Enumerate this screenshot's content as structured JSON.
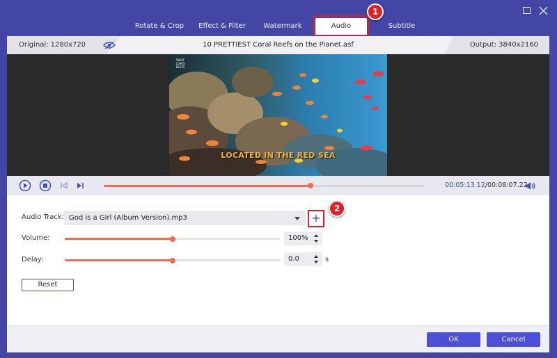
{
  "tabs": [
    {
      "label": "Rotate & Crop",
      "active": false
    },
    {
      "label": "Effect & Filter",
      "active": false
    },
    {
      "label": "Watermark",
      "active": false
    },
    {
      "label": "Audio",
      "active": true
    },
    {
      "label": "Subtitle",
      "active": false
    }
  ],
  "callouts": {
    "one": "1",
    "two": "2"
  },
  "info": {
    "original": "Original: 1280x720",
    "file_name": "10 PRETTIEST Coral Reefs on the Planet.asf",
    "output": "Output: 3840x2160"
  },
  "video": {
    "caption": "LOCATED IN THE RED SEA",
    "logo_text": "WHAT LOVES DELTA"
  },
  "playback": {
    "current_time": "00:05:13.12",
    "total_time": "/00:08:07.22",
    "progress": 0.642
  },
  "audio_track": {
    "label": "Audio Track:",
    "value": "God is a Girl (Album Version).mp3",
    "add_symbol": "+"
  },
  "volume": {
    "label": "Volume:",
    "value": "100%",
    "level": 0.5
  },
  "delay": {
    "label": "Delay:",
    "value": "0.0",
    "unit": "s",
    "level": 0.5
  },
  "buttons": {
    "reset": "Reset",
    "ok": "OK",
    "cancel": "Cancel"
  },
  "colors": {
    "background": "#4446a6",
    "accent": "#f06c4d",
    "primary_button": "#4c4fd8",
    "highlight": "#e01f26"
  }
}
